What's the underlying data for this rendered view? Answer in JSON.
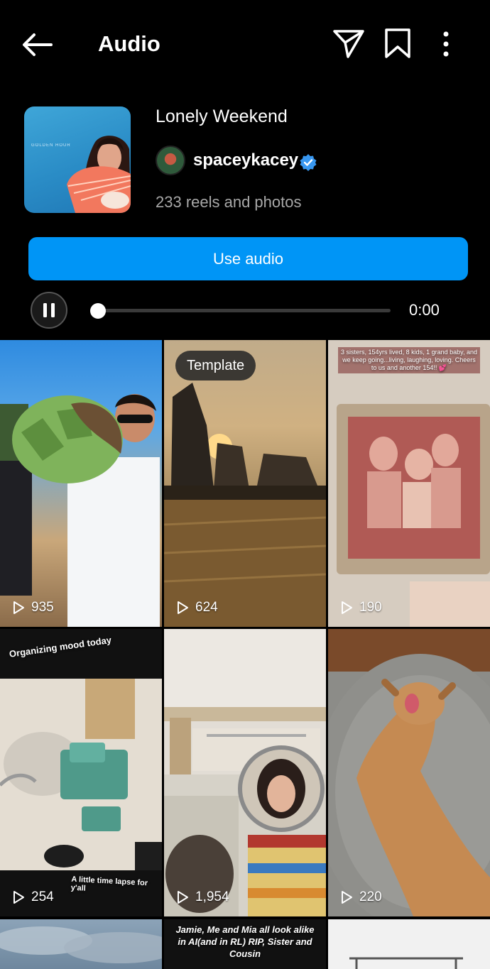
{
  "header": {
    "title": "Audio"
  },
  "track": {
    "title": "Lonely Weekend",
    "artist": "spaceykacey",
    "reels_count": "233 reels and photos",
    "cover_text": "GOLDEN HOUR"
  },
  "actions": {
    "use_audio_label": "Use audio"
  },
  "player": {
    "time": "0:00",
    "progress": 0
  },
  "grid": {
    "tiles": [
      {
        "views": "935"
      },
      {
        "views": "624",
        "badge": "Template"
      },
      {
        "views": "190",
        "caption": "3 sisters, 154yrs lived, 8 kids, 1 grand baby, and we keep going...living, laughing, loving. Cheers to us and another 154!! 💕"
      },
      {
        "views": "254",
        "caption": "Organizing mood today",
        "caption2": "A little time lapse for y'all"
      },
      {
        "views": "1,954"
      },
      {
        "views": "220"
      },
      {},
      {
        "caption": "Jamie, Me and Mia all look alike in AI(and in RL) RIP, Sister and Cousin"
      },
      {}
    ]
  },
  "icons": [
    "back-arrow-icon",
    "send-icon",
    "bookmark-icon",
    "more-icon",
    "verified-icon",
    "pause-icon",
    "play-icon"
  ],
  "colors": {
    "accent": "#0095f6",
    "background": "#000000",
    "secondary_text": "#a8a8a8"
  }
}
